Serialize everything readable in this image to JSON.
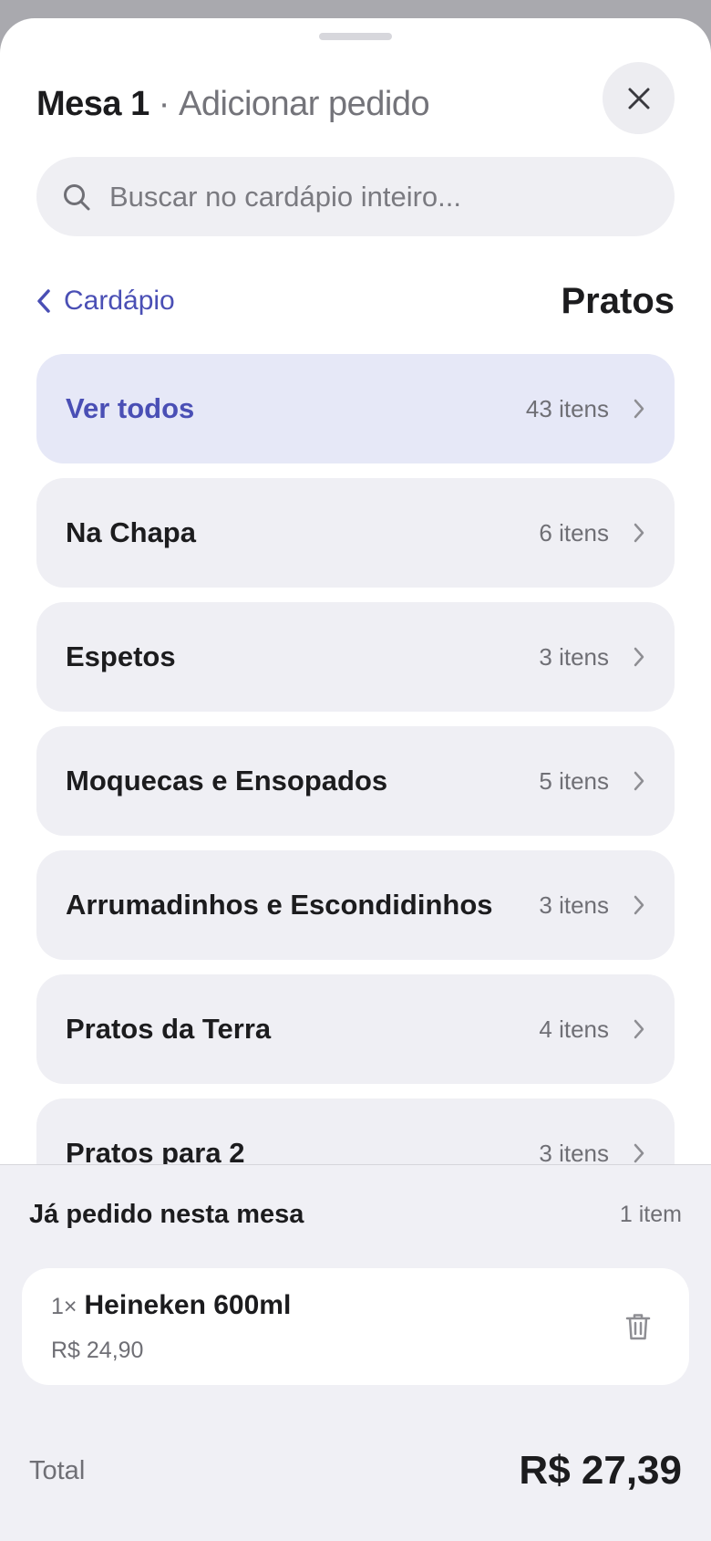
{
  "header": {
    "table_name": "Mesa 1",
    "separator": " · ",
    "action": "Adicionar pedido",
    "close_icon": "close-icon"
  },
  "search": {
    "placeholder": "Buscar no cardápio inteiro...",
    "value": "",
    "icon": "search-icon"
  },
  "nav": {
    "back_label": "Cardápio",
    "back_icon": "chevron-left-icon",
    "section_title": "Pratos"
  },
  "categories": [
    {
      "name": "Ver todos",
      "count": "43 itens",
      "active": true
    },
    {
      "name": "Na Chapa",
      "count": "6 itens"
    },
    {
      "name": "Espetos",
      "count": "3 itens"
    },
    {
      "name": "Moquecas e Ensopados",
      "count": "5 itens"
    },
    {
      "name": "Arrumadinhos e Escondidinhos",
      "count": "3 itens"
    },
    {
      "name": "Pratos da Terra",
      "count": "4 itens"
    },
    {
      "name": "Pratos para 2",
      "count": "3 itens"
    }
  ],
  "ordered": {
    "title": "Já pedido nesta mesa",
    "count": "1 item",
    "items": [
      {
        "qty": "1×",
        "name": "Heineken 600ml",
        "price": "R$ 24,90",
        "delete_icon": "trash-icon"
      }
    ]
  },
  "total": {
    "label": "Total",
    "value": "R$ 27,39"
  },
  "colors": {
    "accent": "#4a4fb5",
    "active_row_bg": "#e6e8f7",
    "row_bg": "#efeff4",
    "footer_bg": "#f0f0f5"
  }
}
